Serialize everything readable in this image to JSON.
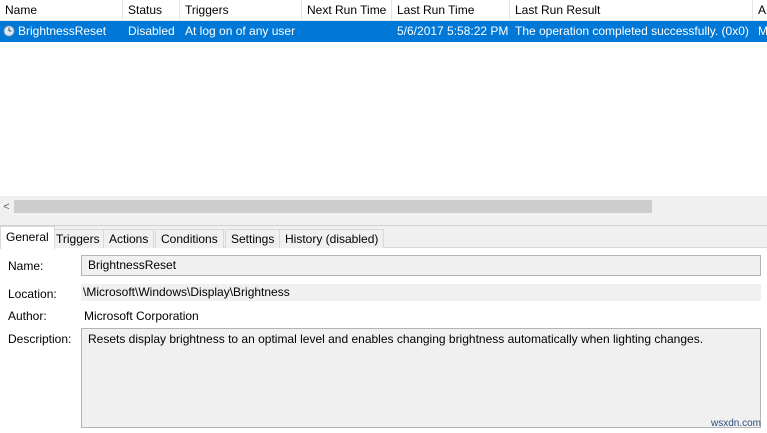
{
  "task_list": {
    "columns": [
      "Name",
      "Status",
      "Triggers",
      "Next Run Time",
      "Last Run Time",
      "Last Run Result",
      "A"
    ],
    "rows": [
      {
        "name": "BrightnessReset",
        "status": "Disabled",
        "triggers": "At log on of any user",
        "next_run_time": "",
        "last_run_time": "5/6/2017 5:58:22 PM",
        "last_run_result": "The operation completed successfully. (0x0)",
        "author_cut": "M",
        "icon": "clock-icon",
        "selected": true
      }
    ]
  },
  "scrollbar": {
    "left_arrow": "<"
  },
  "tabs": [
    "General",
    "Triggers",
    "Actions",
    "Conditions",
    "Settings",
    "History (disabled)"
  ],
  "active_tab": "General",
  "general": {
    "name_label": "Name:",
    "name_value": "BrightnessReset",
    "location_label": "Location:",
    "location_value": "\\Microsoft\\Windows\\Display\\Brightness",
    "author_label": "Author:",
    "author_value": "Microsoft Corporation",
    "description_label": "Description:",
    "description_value": "Resets display brightness to an optimal level and enables changing brightness automatically when lighting changes."
  },
  "watermark": "wsxdn.com",
  "colors": {
    "selection": "#0078d7",
    "panel": "#f0f0f0",
    "border": "#b4b4b4"
  }
}
